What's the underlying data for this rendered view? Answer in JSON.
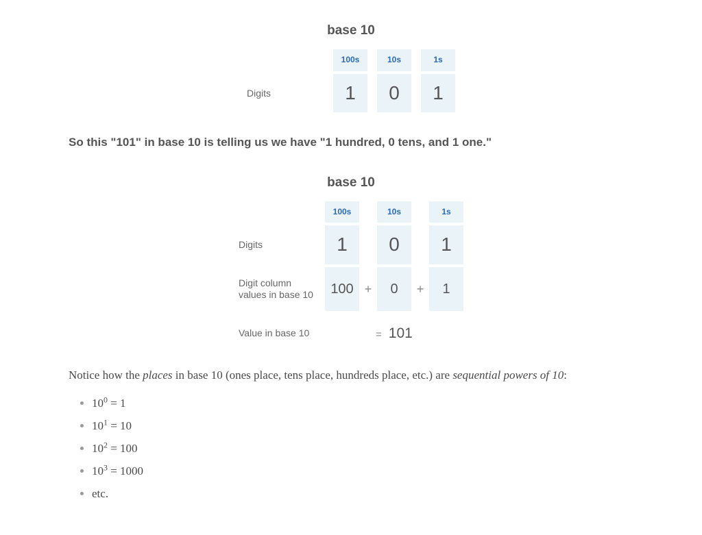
{
  "table1": {
    "title": "base 10",
    "rowlabel_digits": "Digits",
    "cols": {
      "h1": "100s",
      "h2": "10s",
      "h3": "1s"
    },
    "digits": {
      "d1": "1",
      "d2": "0",
      "d3": "1"
    }
  },
  "emphasis": "So this \"101\" in base 10 is telling us we have \"1 hundred, 0 tens, and 1 one.\"",
  "table2": {
    "title": "base 10",
    "rowlabel_digits": "Digits",
    "rowlabel_values": "Digit column values in base 10",
    "rowlabel_result": "Value in base 10",
    "cols": {
      "h1": "100s",
      "h2": "10s",
      "h3": "1s"
    },
    "digits": {
      "d1": "1",
      "d2": "0",
      "d3": "1"
    },
    "values": {
      "v1": "100",
      "v2": "0",
      "v3": "1",
      "op1": "+",
      "op2": "+"
    },
    "result": {
      "eq": "=",
      "val": "101"
    }
  },
  "para": {
    "pre": "Notice how the ",
    "em1": "places",
    "mid": " in base 10 (ones place, tens place, hundreds place, etc.) are ",
    "em2": "sequential powers of 10",
    "post": ":"
  },
  "powers": {
    "p0": {
      "base": "10",
      "exp": "0",
      "eq": " = ",
      "val": "1"
    },
    "p1": {
      "base": "10",
      "exp": "1",
      "eq": " = ",
      "val": "10"
    },
    "p2": {
      "base": "10",
      "exp": "2",
      "eq": " = ",
      "val": "100"
    },
    "p3": {
      "base": "10",
      "exp": "3",
      "eq": " = ",
      "val": "1000"
    },
    "etc": "etc."
  }
}
